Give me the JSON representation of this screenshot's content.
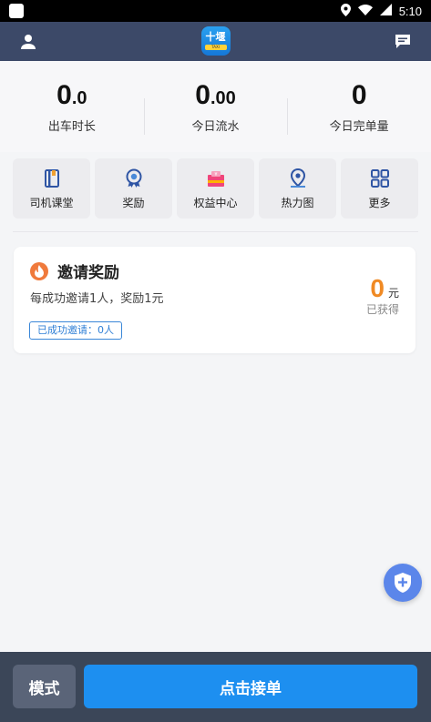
{
  "status_bar": {
    "time": "5:10"
  },
  "header": {
    "logo_text": "十堰",
    "logo_strip": "TAXI"
  },
  "stats": [
    {
      "int": "0",
      "dec": ".0",
      "label": "出车时长"
    },
    {
      "int": "0",
      "dec": ".00",
      "label": "今日流水"
    },
    {
      "int": "0",
      "dec": "",
      "label": "今日完单量"
    }
  ],
  "menu": [
    {
      "label": "司机课堂",
      "icon": "book-icon"
    },
    {
      "label": "奖励",
      "icon": "medal-icon"
    },
    {
      "label": "权益中心",
      "icon": "gift-icon"
    },
    {
      "label": "热力图",
      "icon": "location-pin-icon"
    },
    {
      "label": "更多",
      "icon": "grid-icon"
    }
  ],
  "invite": {
    "title": "邀请奖励",
    "description": "每成功邀请1人，奖励1元",
    "badge": "已成功邀请：0人",
    "amount": "0",
    "unit": "元",
    "amount_label": "已获得"
  },
  "bottom": {
    "mode_label": "模式",
    "accept_label": "点击接单"
  },
  "colors": {
    "header_bg": "#3c4968",
    "accent": "#1d8ff0",
    "reward": "#f08a24",
    "bottom_bg": "#3b4658"
  }
}
